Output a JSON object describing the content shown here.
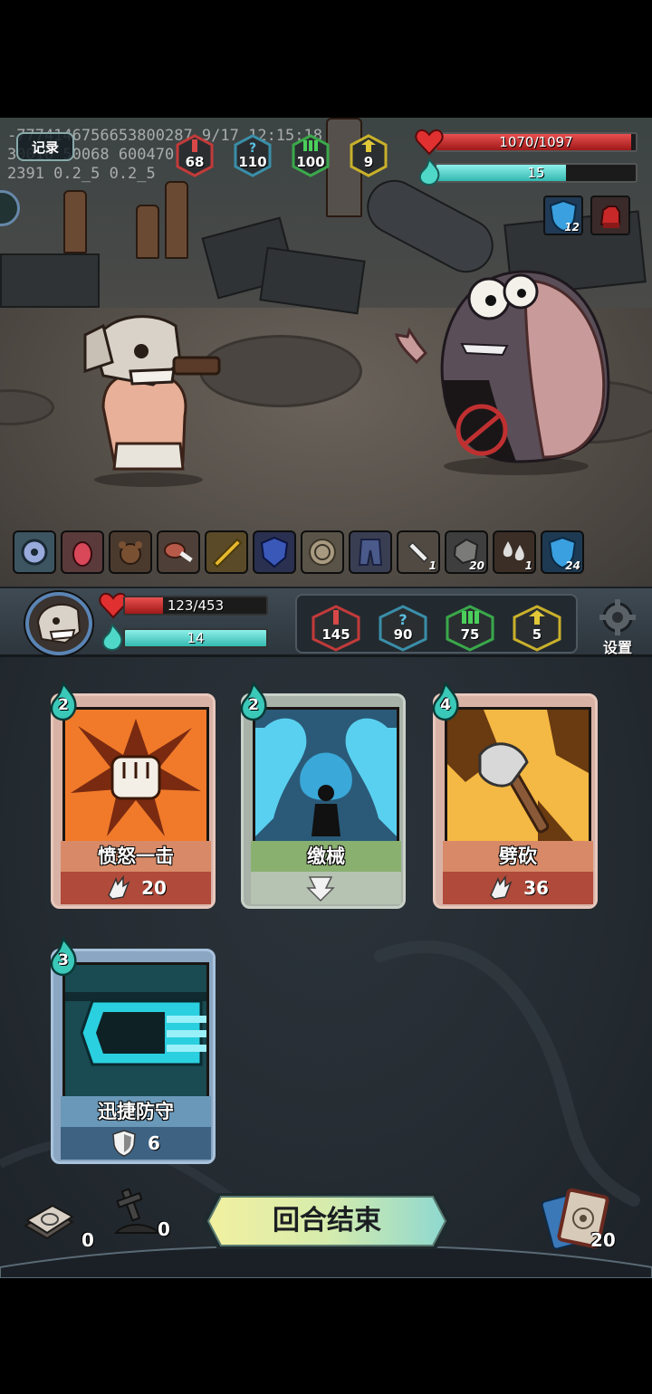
{
  "debug": {
    "line1": "-7774146756653800287 9/17 12:15:18",
    "line2": "30016 50068 600470",
    "line3": "2391 0.2_5 0.2_5"
  },
  "record_button": {
    "label": "记录"
  },
  "enemy": {
    "hp_text": "1070/1097",
    "hp_fraction": 0.975,
    "energy_text": "15",
    "energy_fraction": 0.65,
    "stats": [
      {
        "icon": "attack-sword-icon",
        "value": "68",
        "color": "#c23a3a"
      },
      {
        "icon": "mystery-question-icon",
        "value": "110",
        "color": "#3a8ea8"
      },
      {
        "icon": "defense-green-icon",
        "value": "100",
        "color": "#3aa84a"
      },
      {
        "icon": "speed-yellow-icon",
        "value": "9",
        "color": "#c8b02a"
      }
    ],
    "buffs": [
      {
        "icon": "shield-icon",
        "count": "12"
      },
      {
        "icon": "gauntlet-icon",
        "count": ""
      }
    ]
  },
  "relics": [
    {
      "icon": "compass-icon",
      "count": ""
    },
    {
      "icon": "red-creature-icon",
      "count": ""
    },
    {
      "icon": "bear-toy-icon",
      "count": ""
    },
    {
      "icon": "meat-bone-icon",
      "count": ""
    },
    {
      "icon": "golden-horn-icon",
      "count": ""
    },
    {
      "icon": "blue-badge-icon",
      "count": ""
    },
    {
      "icon": "coin-icon",
      "count": ""
    },
    {
      "icon": "pants-icon",
      "count": ""
    },
    {
      "icon": "bone-icon",
      "count": "1"
    },
    {
      "icon": "stone-icon",
      "count": "20"
    },
    {
      "icon": "water-drops-icon",
      "count": "1"
    },
    {
      "icon": "shield-icon",
      "count": "24"
    }
  ],
  "player": {
    "hp_text": "123/453",
    "hp_fraction": 0.27,
    "energy_text": "14",
    "energy_fraction": 1.0,
    "stats": [
      {
        "icon": "attack-sword-icon",
        "value": "145",
        "color": "#c23a3a"
      },
      {
        "icon": "mystery-question-icon",
        "value": "90",
        "color": "#3a8ea8"
      },
      {
        "icon": "defense-green-icon",
        "value": "75",
        "color": "#3aa84a"
      },
      {
        "icon": "speed-yellow-icon",
        "value": "5",
        "color": "#c8b02a"
      }
    ],
    "settings_label": "设置"
  },
  "cards": [
    {
      "name": "愤怒一击",
      "cost": "2",
      "effect_icon": "claw-icon",
      "effect_value": "20",
      "theme": "red"
    },
    {
      "name": "缴械",
      "cost": "2",
      "effect_icon": "down-arrow-icon",
      "effect_value": "",
      "theme": "green"
    },
    {
      "name": "劈砍",
      "cost": "4",
      "effect_icon": "claw-icon",
      "effect_value": "36",
      "theme": "red"
    },
    {
      "name": "迅捷防守",
      "cost": "3",
      "effect_icon": "shield-icon",
      "effect_value": "6",
      "theme": "blue"
    }
  ],
  "end_turn": {
    "label": "回合结束"
  },
  "piles": {
    "discard_count": "0",
    "exhaust_count": "0",
    "draw_count": "20"
  }
}
